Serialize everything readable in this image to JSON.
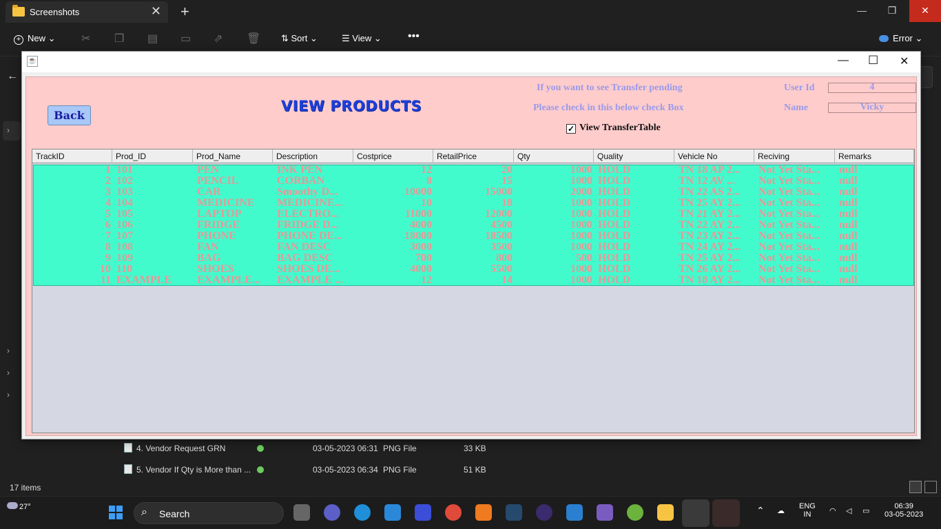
{
  "explorer": {
    "tab_title": "Screenshots",
    "new_tab": "+",
    "minimize": "—",
    "restore": "❐",
    "close": "✕",
    "toolbar": {
      "new_label": "New",
      "sort_label": "Sort",
      "view_label": "View",
      "more_label": "•••",
      "error_label": "Error"
    },
    "files": [
      {
        "name": "4. Vendor Request GRN",
        "date": "03-05-2023 06:31",
        "type": "PNG File",
        "size": "33 KB"
      },
      {
        "name": "5. Vendor If Qty is More than ...",
        "date": "03-05-2023 06:34",
        "type": "PNG File",
        "size": "51 KB"
      }
    ],
    "status_items": "17 items"
  },
  "taskbar": {
    "weather_temp": "27°",
    "search_label": "Search",
    "lang_1": "ENG",
    "lang_2": "IN",
    "time": "06:39",
    "date": "03-05-2023"
  },
  "app": {
    "back_label": "Back",
    "title": "VIEW PRODUCTS",
    "hint_line1": "If you want to see Transfer pending",
    "hint_line2": "Please check in this below check Box",
    "user_id_label": "User Id",
    "user_id_value": "4",
    "name_label": "Name",
    "name_value": "Vicky",
    "checkbox_label": "View TransferTable",
    "checkbox_checked": true,
    "columns": [
      "TrackID",
      "Prod_ID",
      "Prod_Name",
      "Description",
      "Costprice",
      "RetailPrice",
      "Qty",
      "Quality",
      "Vehicle No",
      "Reciving",
      "Remarks"
    ],
    "rows": [
      [
        "1",
        "101",
        "PEN",
        "INK PEN",
        "12",
        "20",
        "1000",
        "HOLD",
        "TN 18 AP 2...",
        "Not Yet Sta...",
        "null"
      ],
      [
        "2",
        "102",
        "PENCIL",
        "CORBAN",
        "8",
        "15",
        "1000",
        "HOLD",
        "TN 12 AV ...",
        "Not Yet Sta...",
        "null"
      ],
      [
        "3",
        "103",
        "CAR",
        "Smoothy D...",
        "10000",
        "15000",
        "2000",
        "HOLD",
        "TN 22 AS 2...",
        "Not Yet Sta...",
        "null"
      ],
      [
        "4",
        "104",
        "MEDICINE",
        "MEDICINE...",
        "10",
        "18",
        "1000",
        "HOLD",
        "TN 25 AY 2...",
        "Not Yet Sta...",
        "null"
      ],
      [
        "5",
        "105",
        "LAPTOP",
        "ELECTRO...",
        "11000",
        "12000",
        "1000",
        "HOLD",
        "TN 21 AY 2...",
        "Not Yet Sta...",
        "null"
      ],
      [
        "6",
        "106",
        "FRIDGE",
        "FRIDGE D...",
        "4000",
        "4500",
        "1000",
        "HOLD",
        "TN 22 AY 2...",
        "Not Yet Sta...",
        "null"
      ],
      [
        "7",
        "107",
        "PHONE",
        "PHONE DE...",
        "18000",
        "18500",
        "1000",
        "HOLD",
        "TN 23 AY 2...",
        "Not Yet Sta...",
        "null"
      ],
      [
        "8",
        "108",
        "FAN",
        "FAN DESC",
        "3000",
        "3500",
        "1000",
        "HOLD",
        "TN 24 AY 2...",
        "Not Yet Sta...",
        "null"
      ],
      [
        "9",
        "109",
        "BAG",
        "BAG DESC",
        "700",
        "800",
        "500",
        "HOLD",
        "TN 25 AY 2...",
        "Not Yet Sta...",
        "null"
      ],
      [
        "10",
        "110",
        "SHOES",
        "SHOES DE...",
        "4000",
        "5500",
        "1000",
        "HOLD",
        "TN 26 AY 2...",
        "Not Yet Sta...",
        "null"
      ],
      [
        "11",
        "EXAMPLE",
        "EXAMPLE...",
        "EXAMPLE ...",
        "12",
        "14",
        "1000",
        "HOLD",
        "TN 18 AY 2...",
        "Not Yet Sta...",
        "null"
      ]
    ]
  },
  "colors": {
    "panel_bg": "#ffcccc",
    "table_rows_bg": "#42fbcd",
    "row_text": "#e89898",
    "title_blue": "#1d3fd8",
    "hint_text": "#9a9ae8"
  }
}
